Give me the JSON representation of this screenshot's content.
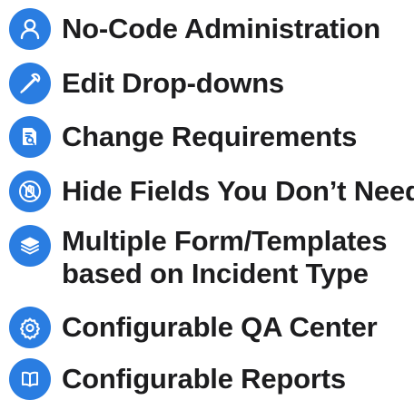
{
  "features": [
    {
      "label": "No-Code Administration",
      "icon": "user-icon"
    },
    {
      "label": "Edit Drop-downs",
      "icon": "dropper-icon"
    },
    {
      "label": "Change Requirements",
      "icon": "document-search-icon"
    },
    {
      "label": "Hide Fields You Don’t Need",
      "icon": "hide-hand-icon"
    },
    {
      "lines": [
        "Multiple Form/Templates",
        "based on Incident Type"
      ],
      "icon": "layers-icon"
    },
    {
      "label": "Configurable QA Center",
      "icon": "gear-icon"
    },
    {
      "label": "Configurable Reports",
      "icon": "book-icon"
    }
  ],
  "colors": {
    "accent": "#2a7de1",
    "text": "#1d1d1f",
    "background": "#ffffff"
  }
}
